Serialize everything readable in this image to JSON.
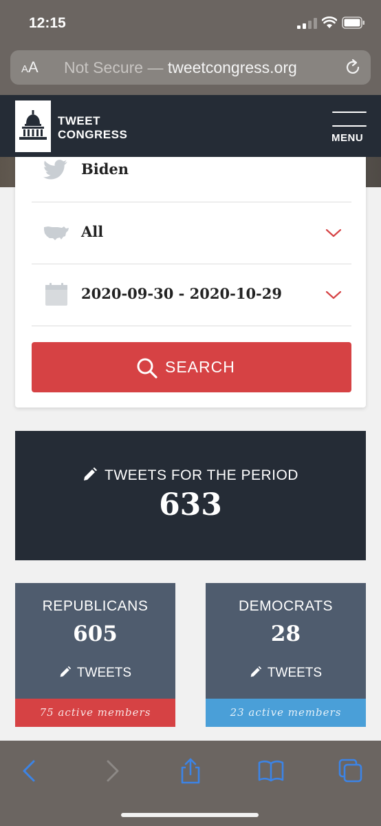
{
  "status_bar": {
    "time": "12:15"
  },
  "browser": {
    "text_size_label": "AA",
    "url_security": "Not Secure",
    "url_separator": " — ",
    "url_domain": "tweetcongress.org"
  },
  "site": {
    "logo_line1": "TWEET",
    "logo_line2": "CONGRESS",
    "menu_label": "MENU"
  },
  "filters": {
    "keyword": "Biden",
    "region": "All",
    "date_range": "2020-09-30 - 2020-10-29",
    "search_label": "SEARCH"
  },
  "totals": {
    "header": "TWEETS FOR THE PERIOD",
    "count": "633"
  },
  "parties": {
    "republicans": {
      "name": "REPUBLICANS",
      "count": "605",
      "tweets_label": "TWEETS",
      "members": "75 active members",
      "accent": "#d64244"
    },
    "democrats": {
      "name": "DEMOCRATS",
      "count": "28",
      "tweets_label": "TWEETS",
      "members": "23 active members",
      "accent": "#4a9fd8"
    }
  },
  "colors": {
    "brand_dark": "#252c36",
    "search_red": "#d64244",
    "party_tile": "#4f5c6e",
    "ios_blue": "#3c84e6"
  },
  "icons": {
    "keyword": "twitter-bird-icon",
    "region": "us-map-icon",
    "date": "calendar-icon",
    "search": "magnifier-icon",
    "tweets": "pencil-icon"
  }
}
